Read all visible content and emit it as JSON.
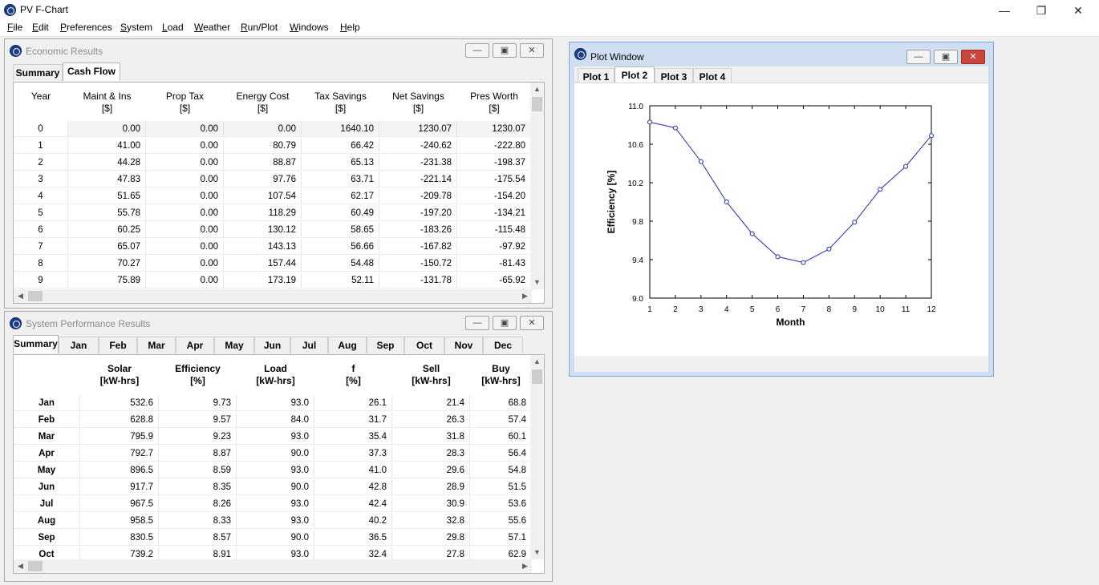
{
  "app": {
    "title": "PV F-Chart"
  },
  "menu": [
    "File",
    "Edit",
    "Preferences",
    "System",
    "Load",
    "Weather",
    "Run/Plot",
    "Windows",
    "Help"
  ],
  "economic": {
    "title": "Economic Results",
    "tabs": [
      "Summary",
      "Cash Flow"
    ],
    "columns": [
      [
        "Year",
        ""
      ],
      [
        "Maint & Ins",
        "[$]"
      ],
      [
        "Prop Tax",
        "[$]"
      ],
      [
        "Energy Cost",
        "[$]"
      ],
      [
        "Tax Savings",
        "[$]"
      ],
      [
        "Net Savings",
        "[$]"
      ],
      [
        "Pres Worth",
        "[$]"
      ]
    ],
    "rows": [
      [
        "0",
        "0.00",
        "0.00",
        "0.00",
        "1640.10",
        "1230.07",
        "1230.07"
      ],
      [
        "1",
        "41.00",
        "0.00",
        "80.79",
        "66.42",
        "-240.62",
        "-222.80"
      ],
      [
        "2",
        "44.28",
        "0.00",
        "88.87",
        "65.13",
        "-231.38",
        "-198.37"
      ],
      [
        "3",
        "47.83",
        "0.00",
        "97.76",
        "63.71",
        "-221.14",
        "-175.54"
      ],
      [
        "4",
        "51.65",
        "0.00",
        "107.54",
        "62.17",
        "-209.78",
        "-154.20"
      ],
      [
        "5",
        "55.78",
        "0.00",
        "118.29",
        "60.49",
        "-197.20",
        "-134.21"
      ],
      [
        "6",
        "60.25",
        "0.00",
        "130.12",
        "58.65",
        "-183.26",
        "-115.48"
      ],
      [
        "7",
        "65.07",
        "0.00",
        "143.13",
        "56.66",
        "-167.82",
        "-97.92"
      ],
      [
        "8",
        "70.27",
        "0.00",
        "157.44",
        "54.48",
        "-150.72",
        "-81.43"
      ],
      [
        "9",
        "75.89",
        "0.00",
        "173.19",
        "52.11",
        "-131.78",
        "-65.92"
      ]
    ]
  },
  "performance": {
    "title": "System Performance Results",
    "tabs": [
      "Summary",
      "Jan",
      "Feb",
      "Mar",
      "Apr",
      "May",
      "Jun",
      "Jul",
      "Aug",
      "Sep",
      "Oct",
      "Nov",
      "Dec"
    ],
    "columns": [
      [
        "Solar",
        "[kW-hrs]"
      ],
      [
        "Efficiency",
        "[%]"
      ],
      [
        "Load",
        "[kW-hrs]"
      ],
      [
        "f",
        "[%]"
      ],
      [
        "Sell",
        "[kW-hrs]"
      ],
      [
        "Buy",
        "[kW-hrs]"
      ]
    ],
    "rows": [
      [
        "Jan",
        "532.6",
        "9.73",
        "93.0",
        "26.1",
        "21.4",
        "68.8"
      ],
      [
        "Feb",
        "628.8",
        "9.57",
        "84.0",
        "31.7",
        "26.3",
        "57.4"
      ],
      [
        "Mar",
        "795.9",
        "9.23",
        "93.0",
        "35.4",
        "31.8",
        "60.1"
      ],
      [
        "Apr",
        "792.7",
        "8.87",
        "90.0",
        "37.3",
        "28.3",
        "56.4"
      ],
      [
        "May",
        "896.5",
        "8.59",
        "93.0",
        "41.0",
        "29.6",
        "54.8"
      ],
      [
        "Jun",
        "917.7",
        "8.35",
        "90.0",
        "42.8",
        "28.9",
        "51.5"
      ],
      [
        "Jul",
        "967.5",
        "8.26",
        "93.0",
        "42.4",
        "30.9",
        "53.6"
      ],
      [
        "Aug",
        "958.5",
        "8.33",
        "93.0",
        "40.2",
        "32.8",
        "55.6"
      ],
      [
        "Sep",
        "830.5",
        "8.57",
        "90.0",
        "36.5",
        "29.8",
        "57.1"
      ],
      [
        "Oct",
        "739.2",
        "8.91",
        "93.0",
        "32.4",
        "27.8",
        "62.9"
      ]
    ]
  },
  "plot": {
    "title": "Plot Window",
    "tabs": [
      "Plot 1",
      "Plot 2",
      "Plot 3",
      "Plot 4"
    ],
    "selected_tab": "Plot 2"
  },
  "chart_data": {
    "type": "line",
    "x": [
      1,
      2,
      3,
      4,
      5,
      6,
      7,
      8,
      9,
      10,
      11,
      12
    ],
    "series": [
      {
        "values": [
          10.83,
          10.77,
          10.42,
          10.0,
          9.67,
          9.43,
          9.37,
          9.51,
          9.79,
          10.13,
          10.37,
          10.69
        ]
      }
    ],
    "xlabel": "Month",
    "ylabel": "Efficiency  [%]",
    "xlim": [
      1,
      12
    ],
    "ylim": [
      9.0,
      11.0
    ],
    "xticks": [
      "1",
      "2",
      "3",
      "4",
      "5",
      "6",
      "7",
      "8",
      "9",
      "10",
      "11",
      "12"
    ],
    "yticks": [
      "9.0",
      "9.4",
      "9.8",
      "10.2",
      "10.6",
      "11.0"
    ],
    "line_color": "#1f2fa8",
    "marker": "circle-open",
    "grid": false
  }
}
